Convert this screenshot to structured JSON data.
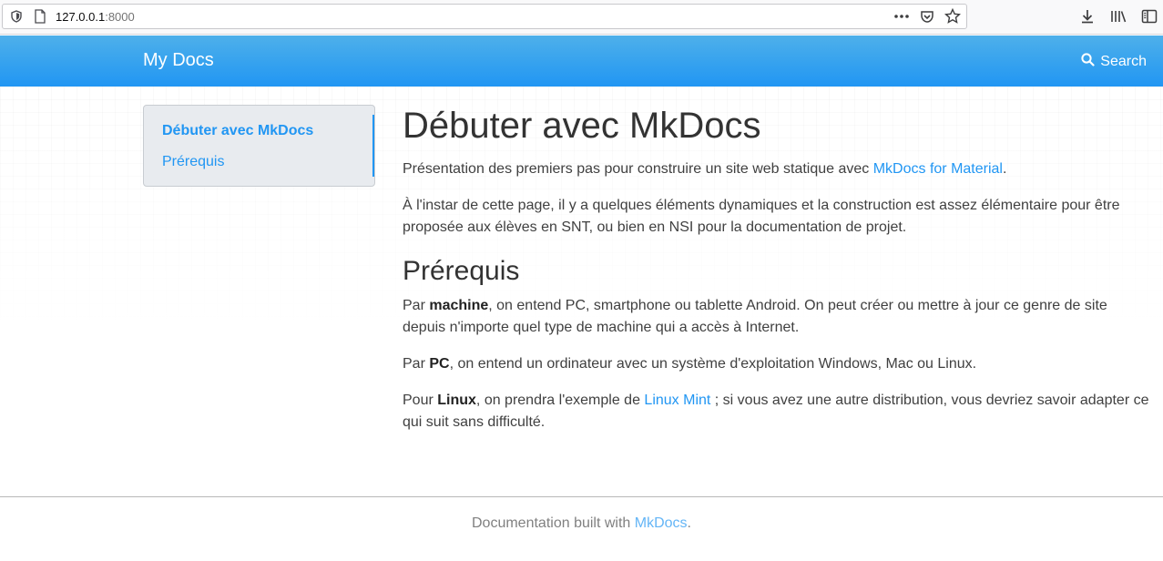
{
  "browser": {
    "url_host": "127.0.0.1",
    "url_port": ":8000"
  },
  "header": {
    "brand": "My Docs",
    "search_label": "Search"
  },
  "sidebar": {
    "items": [
      {
        "label": "Débuter avec MkDocs"
      },
      {
        "label": "Prérequis"
      }
    ]
  },
  "content": {
    "title": "Débuter avec MkDocs",
    "intro_text": "Présentation des premiers pas pour construire un site web statique avec ",
    "intro_link": "MkDocs for Material",
    "intro_end": ".",
    "para2": "À l'instar de cette page, il y a quelques éléments dynamiques et la construction est assez élémentaire pour être proposée aux élèves en SNT, ou bien en NSI pour la documentation de projet.",
    "section_title": "Prérequis",
    "p_machine_pre": "Par ",
    "p_machine_bold": "machine",
    "p_machine_post": ", on entend PC, smartphone ou tablette Android. On peut créer ou mettre à jour ce genre de site depuis n'importe quel type de machine qui a accès à Internet.",
    "p_pc_pre": "Par ",
    "p_pc_bold": "PC",
    "p_pc_post": ", on entend un ordinateur avec un système d'exploitation Windows, Mac ou Linux.",
    "p_linux_pre": "Pour ",
    "p_linux_bold": "Linux",
    "p_linux_mid": ", on prendra l'exemple de ",
    "p_linux_link": "Linux Mint",
    "p_linux_post": " ; si vous avez une autre distribution, vous devriez savoir adapter ce qui suit sans difficulté."
  },
  "footer": {
    "text": "Documentation built with ",
    "link": "MkDocs",
    "end": "."
  },
  "colors": {
    "accent": "#2196f3",
    "header_top": "#4eb0ea"
  }
}
